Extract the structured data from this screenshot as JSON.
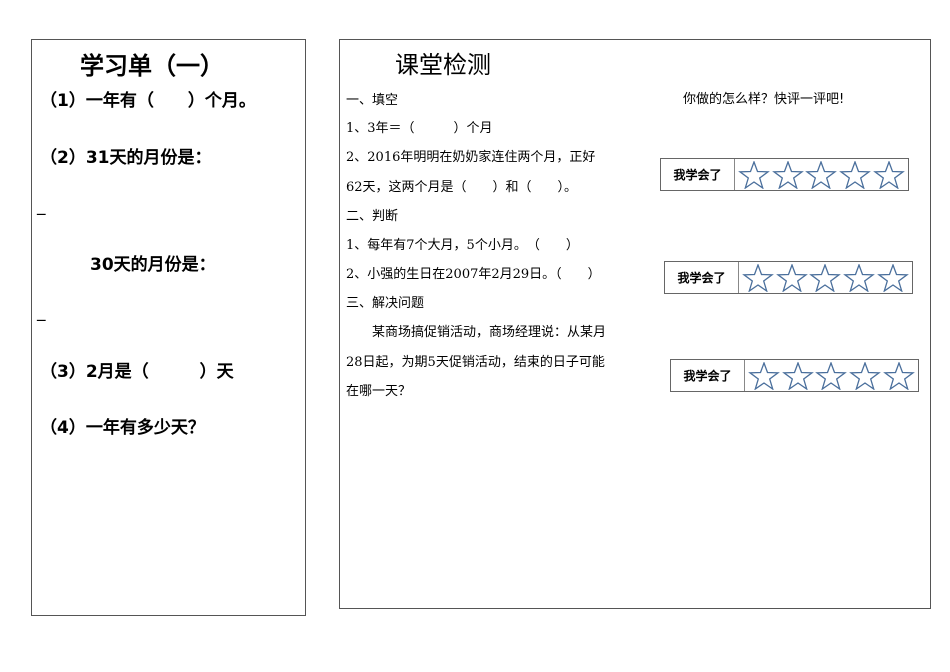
{
  "left": {
    "title": "学习单（一）",
    "q1": "（1）一年有（　　）个月。",
    "q2": "（2）31天的月份是：",
    "blank1": "_",
    "q2b": "30天的月份是：",
    "blank2": "_",
    "q3": "（3）2月是（　　　）天",
    "q4": "（4）一年有多少天？"
  },
  "right": {
    "title": "课堂检测",
    "prompt": "你做的怎么样？快评一评吧!",
    "s1": "一、填空",
    "s1q1": "1、3年＝（　　　）个月",
    "s1q2a": "2、2016年明明在奶奶家连住两个月，正好",
    "s1q2b": "62天，这两个月是（　　）和（　　）。",
    "s2": "二、判断",
    "s2q1": "1、每年有7个大月，5个小月。　（　　）",
    "s2q2": "2、小强的生日在2007年2月29日。（　　）",
    "s3": "三、解决问题",
    "s3a": "　　某商场搞促销活动，商场经理说：从某月",
    "s3b": "28日起，为期5天促销活动，结束的日子可能",
    "s3c": "在哪一天？",
    "rating_label": "我学会了",
    "star_color": "#4a6f9c"
  }
}
